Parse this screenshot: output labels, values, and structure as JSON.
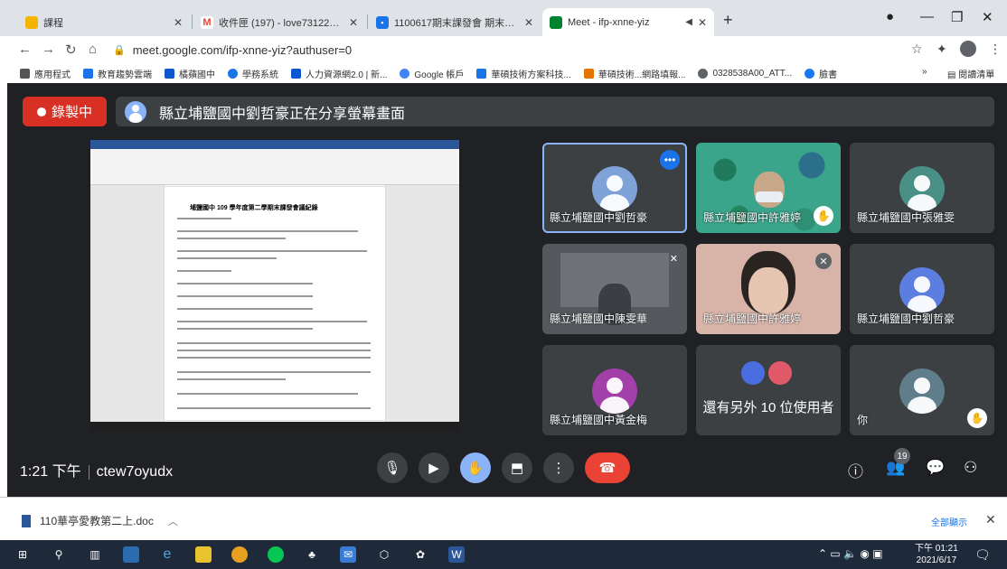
{
  "browser": {
    "tabs": [
      {
        "title": "課程",
        "favicon_color": "#f4b400",
        "active": false
      },
      {
        "title": "收件匣 (197) - love73122828@",
        "favicon_color": "#ea4335",
        "active": false
      },
      {
        "title": "1100617期末課發會 期末課發會",
        "favicon_color": "#1a73e8",
        "active": false
      },
      {
        "title": "Meet - ifp-xnne-yiz",
        "favicon_color": "#00832d",
        "active": true
      }
    ],
    "new_tab": "+",
    "url": "meet.google.com/ifp-xnne-yiz?authuser=0",
    "bookmarks": [
      {
        "label": "應用程式",
        "color": "#555555"
      },
      {
        "label": "教育趨勢雲端",
        "color": "#1a73e8"
      },
      {
        "label": "橘蘋國中",
        "color": "#0b57d0"
      },
      {
        "label": "學務系統",
        "color": "#1a73e8"
      },
      {
        "label": "人力資源網2.0 | 新...",
        "color": "#0b57d0"
      },
      {
        "label": "Google 帳戶",
        "color": "#4285f4"
      },
      {
        "label": "華碩技術方案科技...",
        "color": "#1a73e8"
      },
      {
        "label": "華碩技術...網路填報...",
        "color": "#e37400"
      },
      {
        "label": "0328538A00_ATT...",
        "color": "#5f6368"
      },
      {
        "label": "臉書",
        "color": "#1877f2"
      }
    ],
    "bookmarks_more": "»",
    "reading_list": "閱讀清單"
  },
  "meet": {
    "recording_label": "錄製中",
    "share_banner": "縣立埔鹽國中劉哲豪正在分享螢幕畫面",
    "shared_doc_title": "埔鹽國中 109 學年度第二學期末課發會議紀錄",
    "participants": [
      {
        "name": "縣立埔鹽國中劉哲豪",
        "avatar_color": "#7fa3d9",
        "active": true
      },
      {
        "name": "縣立埔鹽國中許雅婷",
        "video": "aquarium",
        "hand": true
      },
      {
        "name": "縣立埔鹽國中張雅雯",
        "avatar_color": "#4a8f86"
      },
      {
        "name": "縣立埔鹽國中陳雯華",
        "video": "room",
        "mic_off": true
      },
      {
        "name": "縣立埔鹽國中許雅婷",
        "video": "face",
        "mic_off": true
      },
      {
        "name": "縣立埔鹽國中劉哲豪",
        "avatar_color": "#5b7ee0"
      },
      {
        "name": "縣立埔鹽國中黃金梅",
        "avatar_color": "#a33fa8"
      },
      {
        "others_text": "還有另外 10 位使用者"
      },
      {
        "name": "你",
        "avatar_color": "#607d8b",
        "hand": true
      }
    ],
    "time": "1:21 下午",
    "meeting_code": "ctew7oyudx",
    "participant_count": "19"
  },
  "downloads": {
    "file": "110華亭愛教第二上.doc",
    "show_all": "全部顯示"
  },
  "taskbar": {
    "clock_time": "下午 01:21",
    "clock_date": "2021/6/17"
  }
}
